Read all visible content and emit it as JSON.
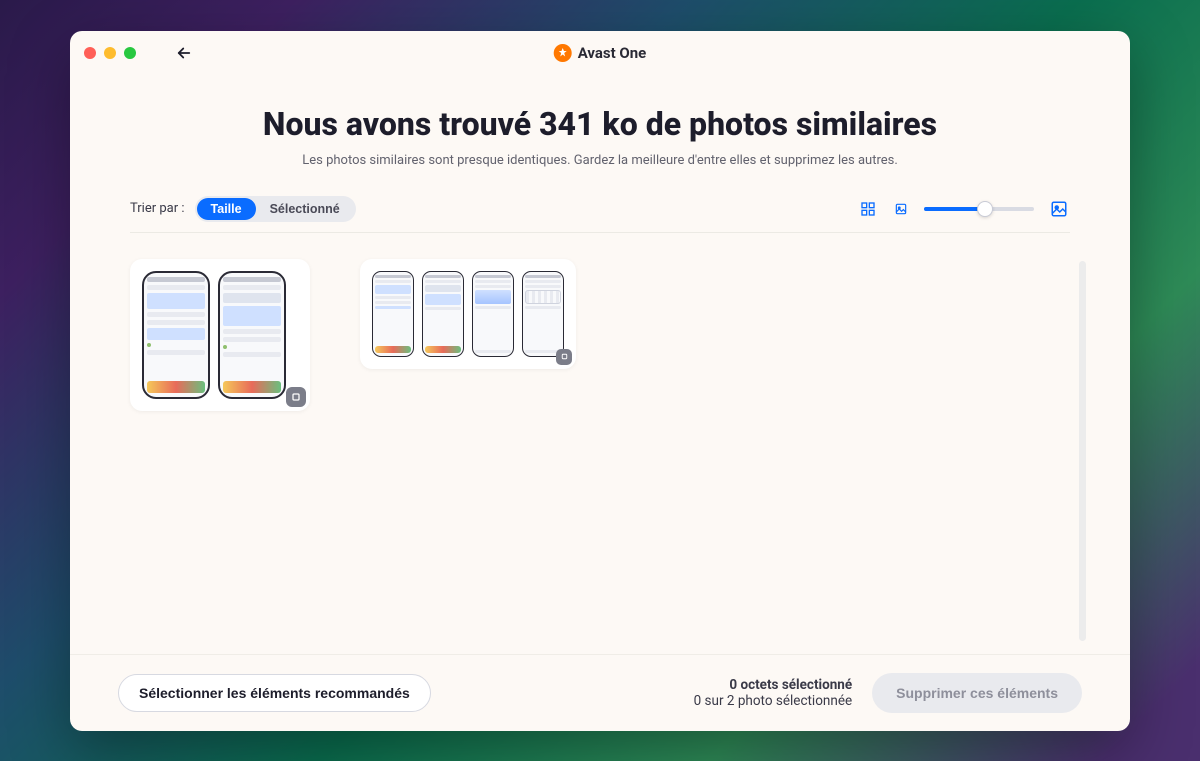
{
  "brand": {
    "name": "Avast One"
  },
  "heading": {
    "before": "Nous avons trouvé ",
    "emphasis": "341 ko",
    "after": " de photos similaires"
  },
  "subheading": "Les photos similaires sont presque identiques. Gardez la meilleure d'entre elles et supprimez les autres.",
  "toolbar": {
    "sort_label": "Trier par :",
    "sort_options": {
      "size": "Taille",
      "selected": "Sélectionné"
    }
  },
  "footer": {
    "select_recommended": "Sélectionner les éléments recommandés",
    "status_line1": "0 octets sélectionné",
    "status_line2": "0 sur 2 photo sélectionnée",
    "delete_label": "Supprimer ces éléments"
  }
}
